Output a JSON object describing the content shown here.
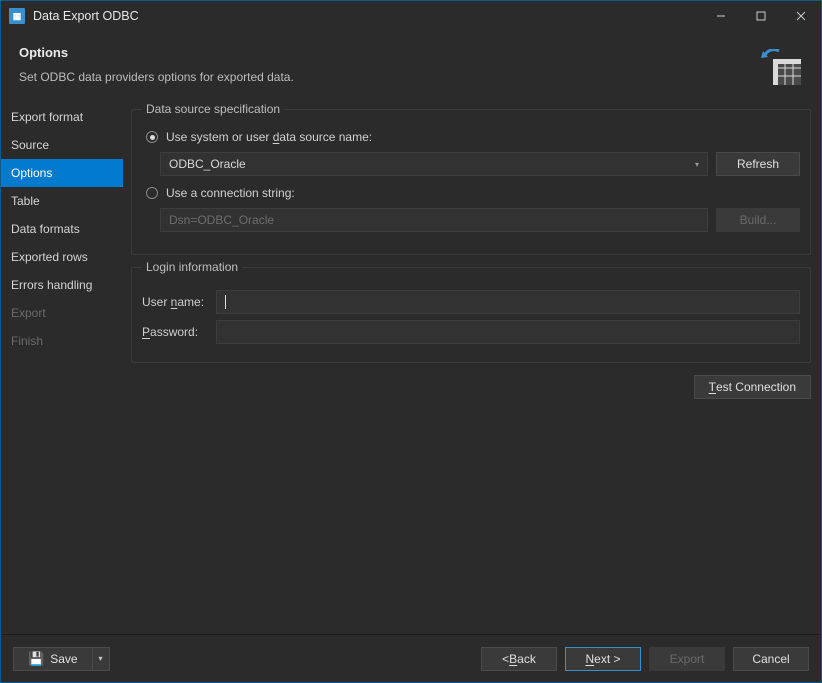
{
  "window": {
    "title": "Data Export ODBC"
  },
  "header": {
    "title": "Options",
    "description": "Set ODBC data providers options for exported data."
  },
  "sidebar": {
    "items": [
      {
        "label": "Export format",
        "state": "normal"
      },
      {
        "label": "Source",
        "state": "normal"
      },
      {
        "label": "Options",
        "state": "selected"
      },
      {
        "label": "Table",
        "state": "normal"
      },
      {
        "label": "Data formats",
        "state": "normal"
      },
      {
        "label": "Exported rows",
        "state": "normal"
      },
      {
        "label": "Errors handling",
        "state": "normal"
      },
      {
        "label": "Export",
        "state": "disabled"
      },
      {
        "label": "Finish",
        "state": "disabled"
      }
    ]
  },
  "datasource": {
    "legend": "Data source specification",
    "radio_dsn": {
      "label_pre": "Use system or user ",
      "label_u": "d",
      "label_post": "ata source name:",
      "checked": true
    },
    "dsn_value": "ODBC_Oracle",
    "refresh_label": "Refresh",
    "radio_conn": {
      "label": "Use a connection string:",
      "checked": false
    },
    "conn_placeholder": "Dsn=ODBC_Oracle",
    "build_label": "Build..."
  },
  "login": {
    "legend": "Login information",
    "username_label_pre": "User ",
    "username_label_u": "n",
    "username_label_post": "ame:",
    "username_value": "",
    "password_label_u": "P",
    "password_label_post": "assword:",
    "password_value": ""
  },
  "test_label_u": "T",
  "test_label_post": "est Connection",
  "footer": {
    "save_label": "Save",
    "back_label_pre": "< ",
    "back_label_u": "B",
    "back_label_post": "ack",
    "next_label_u": "N",
    "next_label_post": "ext >",
    "export_label": "Export",
    "cancel_label": "Cancel"
  }
}
